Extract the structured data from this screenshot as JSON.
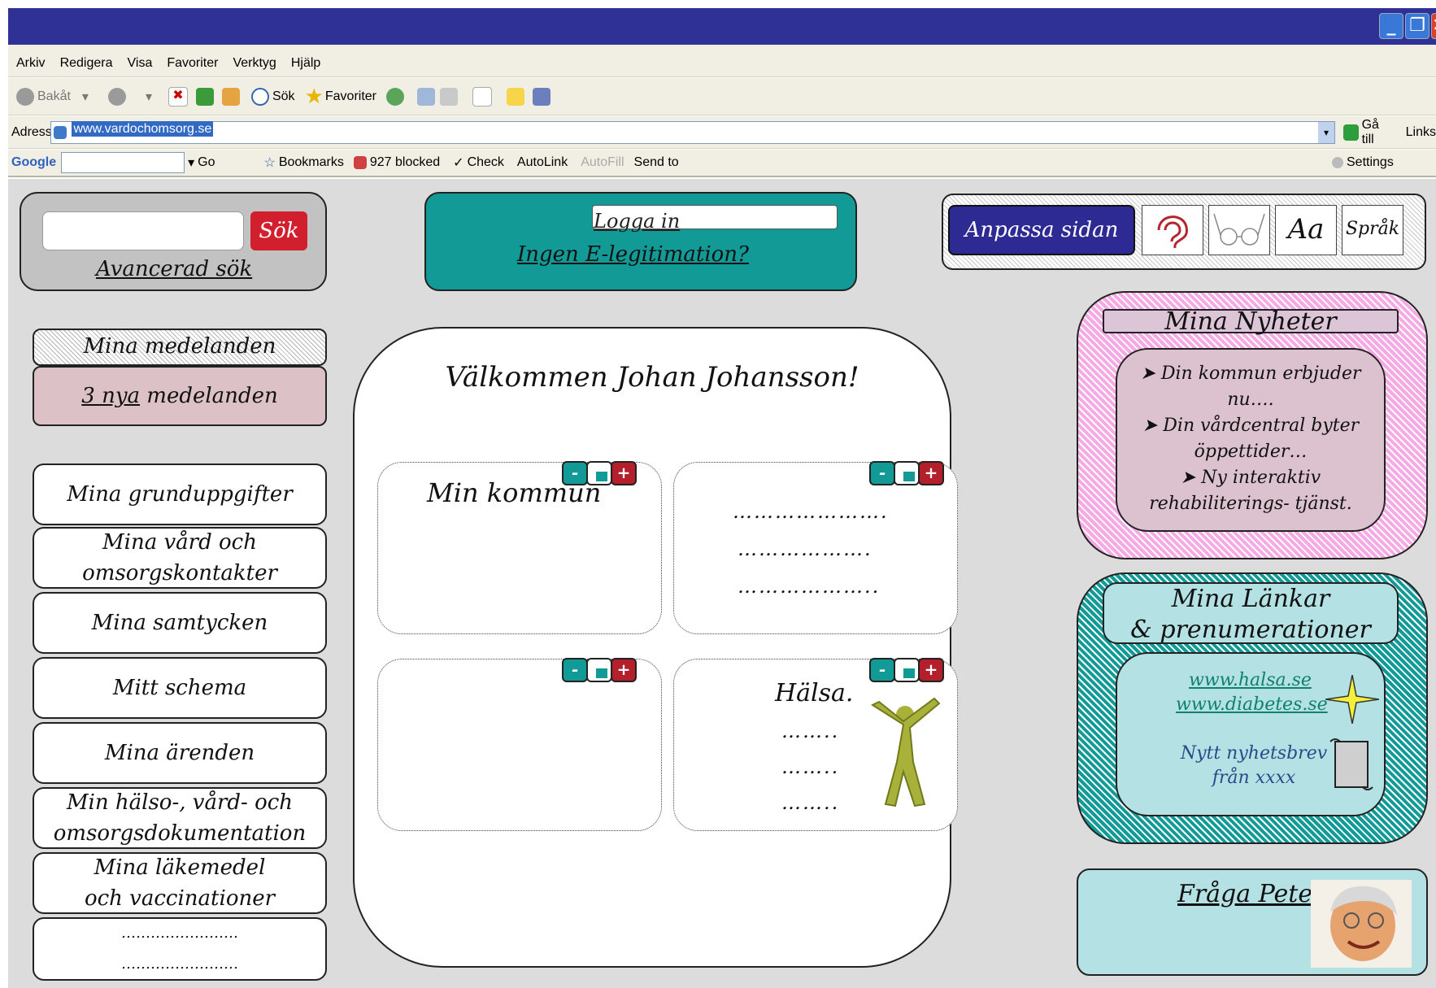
{
  "browser": {
    "menu": [
      "Arkiv",
      "Redigera",
      "Visa",
      "Favoriter",
      "Verktyg",
      "Hjälp"
    ],
    "toolbar": {
      "back": "Bakåt",
      "search": "Sök",
      "favorites": "Favoriter"
    },
    "address": {
      "label": "Adress",
      "url": "www.vardochomsorg.se",
      "go": "Gå till",
      "links": "Links"
    },
    "google": {
      "logo": "Google",
      "go": "Go",
      "bookmarks": "Bookmarks",
      "blocked": "927 blocked",
      "check": "Check",
      "autolink": "AutoLink",
      "autofill": "AutoFill",
      "sendto": "Send to",
      "settings": "Settings"
    }
  },
  "search": {
    "button": "Sök",
    "advanced": "Avancerad sök"
  },
  "login": {
    "login_link": "Logga in",
    "no_eid": "Ingen E-legitimation?"
  },
  "customize": {
    "button": "Anpassa sidan",
    "text_size": "Aa",
    "language": "Språk"
  },
  "messages": {
    "header": "Mina medelanden",
    "new_count": "3 nya",
    "new_suffix": " medelanden"
  },
  "nav": {
    "items": [
      {
        "line1": "Mina grunduppgifter",
        "line2": ""
      },
      {
        "line1": "Mina vård och",
        "line2": "omsorgskontakter"
      },
      {
        "line1": "Mina samtycken",
        "line2": ""
      },
      {
        "line1": "Mitt schema",
        "line2": ""
      },
      {
        "line1": "Mina ärenden",
        "line2": ""
      },
      {
        "line1": "Min hälso-, vård- och",
        "line2": "omsorgsdokumentation"
      },
      {
        "line1": "Mina läkemedel",
        "line2": "och vaccinationer"
      },
      {
        "line1": "……………………",
        "line2": "……………………"
      }
    ]
  },
  "main": {
    "welcome": "Välkommen Johan Johansson!",
    "widget1": {
      "title": "Min kommun"
    },
    "widget2": {
      "lines": [
        "………………….",
        "……………….",
        "……………….."
      ]
    },
    "widget4": {
      "title": "Hälsa.",
      "lines": [
        "……..",
        "……..",
        "…….."
      ]
    },
    "controls": {
      "minimize": "-",
      "plus": "+"
    }
  },
  "news": {
    "title": "Mina Nyheter",
    "items": [
      "Din kommun erbjuder nu….",
      "Din vårdcentral byter öppettider…",
      "Ny interaktiv rehabiliterings- tjänst."
    ]
  },
  "links": {
    "title_line1": "Mina Länkar",
    "title_line2": "& prenumerationer",
    "link1": "www.halsa.se",
    "link2": "www.diabetes.se",
    "newsletter_line1": "Nytt nyhetsbrev",
    "newsletter_line2": "från xxxx"
  },
  "ask": {
    "label": "Fråga Pete"
  },
  "colors": {
    "titlebar": "#2f3196",
    "teal": "#119a96",
    "pink": "#f6a9e4",
    "cyan": "#b4e2e4",
    "red": "#d21f2d",
    "navy": "#2e2a93"
  }
}
